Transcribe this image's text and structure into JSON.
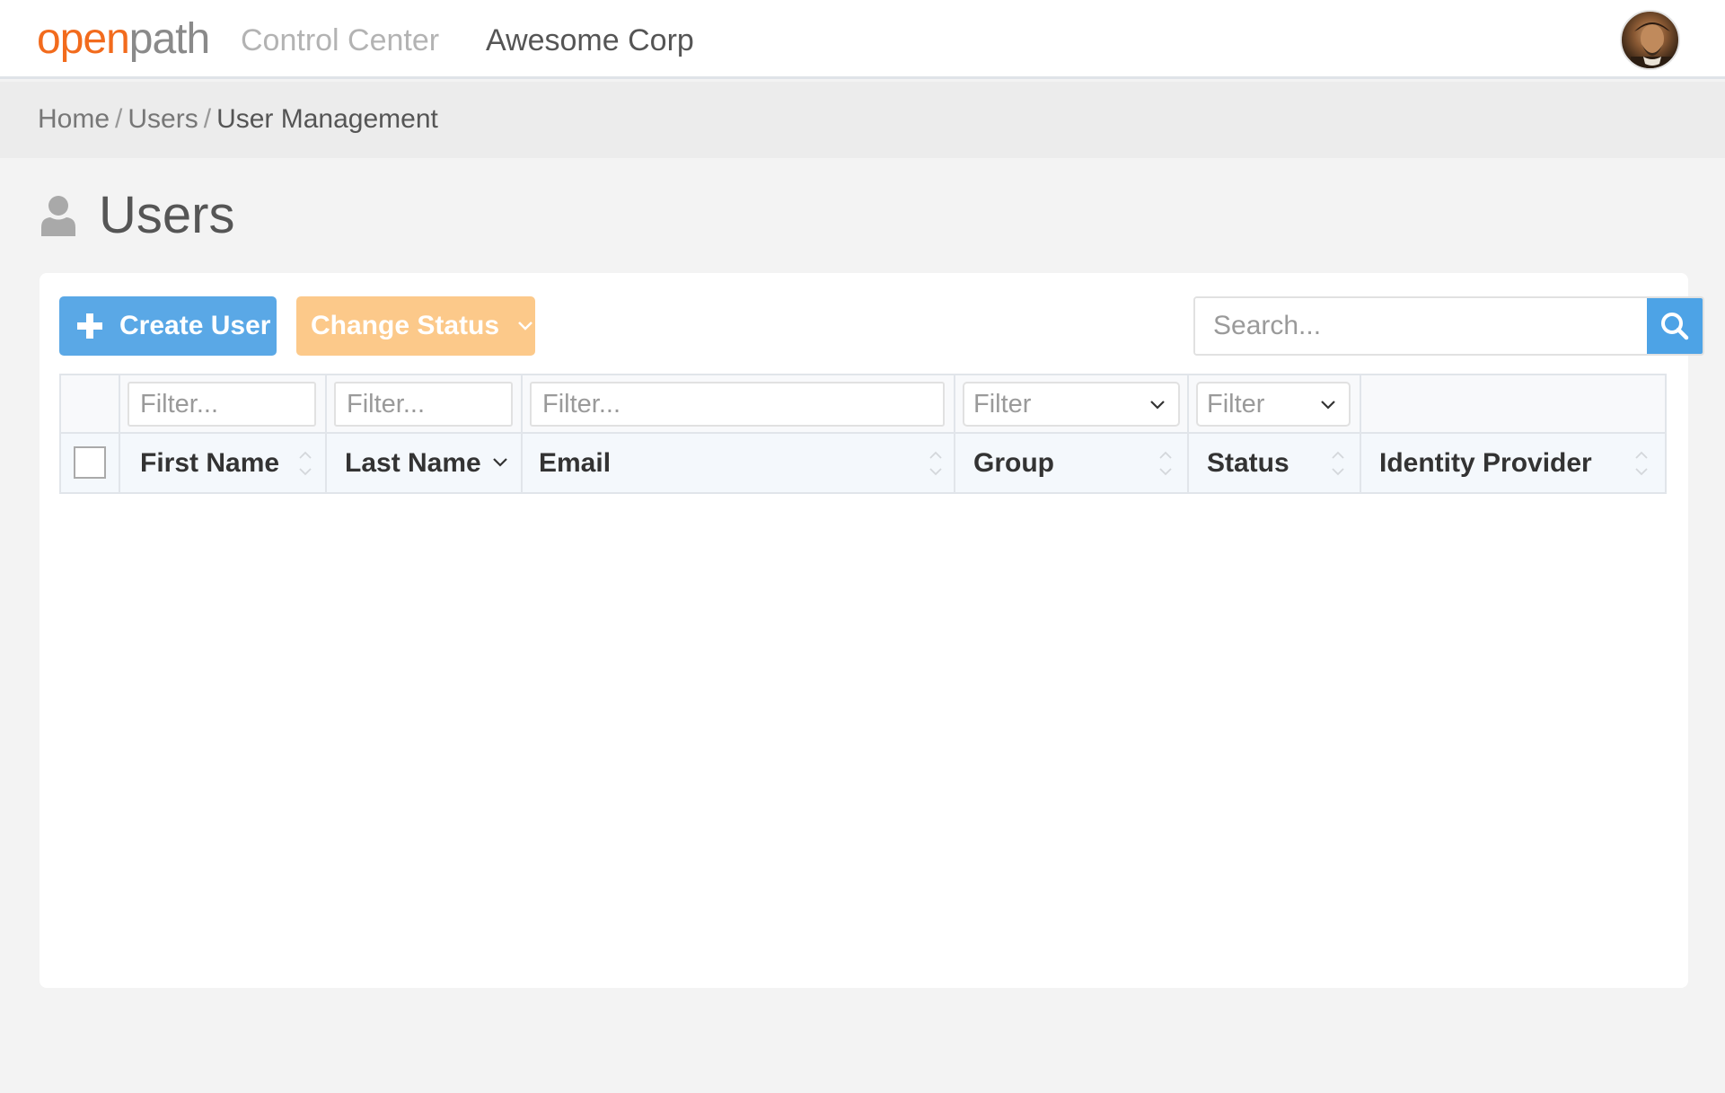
{
  "header": {
    "logo_part1": "open",
    "logo_part2": "path",
    "app_name": "Control Center",
    "org_name": "Awesome Corp",
    "avatar_icon": "user-avatar"
  },
  "breadcrumb": {
    "items": [
      "Home",
      "Users"
    ],
    "current": "User Management",
    "separator": "/"
  },
  "page": {
    "title": "Users",
    "icon": "user-icon"
  },
  "toolbar": {
    "create_label": "Create User",
    "create_icon": "plus-icon",
    "change_status_label": "Change Status",
    "search_placeholder": "Search...",
    "search_icon": "search-icon"
  },
  "table": {
    "filters": {
      "first_name_placeholder": "Filter...",
      "last_name_placeholder": "Filter...",
      "email_placeholder": "Filter...",
      "group_placeholder": "Filter",
      "status_placeholder": "Filter"
    },
    "columns": [
      "First Name",
      "Last Name",
      "Email",
      "Group",
      "Status",
      "Identity Provider"
    ],
    "sorted_column": "Last Name",
    "rows": []
  },
  "colors": {
    "brand_orange": "#f26b1d",
    "primary_blue": "#5aa8e6",
    "warning_light": "#fcc98a"
  }
}
